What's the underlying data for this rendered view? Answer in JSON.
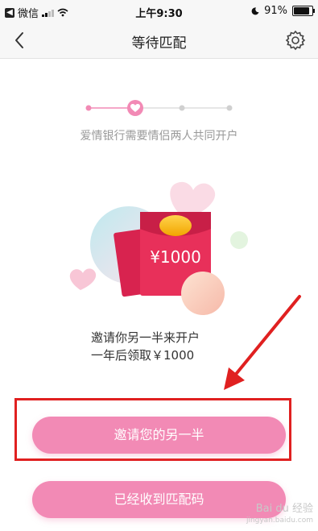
{
  "status_bar": {
    "back_app": "微信",
    "time": "上午9:30",
    "battery": "91%"
  },
  "nav": {
    "title": "等待匹配"
  },
  "progress": {
    "step_label": "爱情银行需要情侣两人共同开户",
    "current_step": 2,
    "total_steps": 4
  },
  "illustration": {
    "amount": "¥1000"
  },
  "description": {
    "line1": "邀请你另一半来开户",
    "line2": "一年后领取￥1000"
  },
  "buttons": {
    "invite": "邀请您的另一半",
    "have_code": "已经收到匹配码"
  },
  "watermark": {
    "brand": "Bai du 经验",
    "url": "jingyan.baidu.com"
  },
  "colors": {
    "accent": "#f28ab5",
    "annotation_red": "#e02020",
    "envelope_red": "#e8305a"
  }
}
